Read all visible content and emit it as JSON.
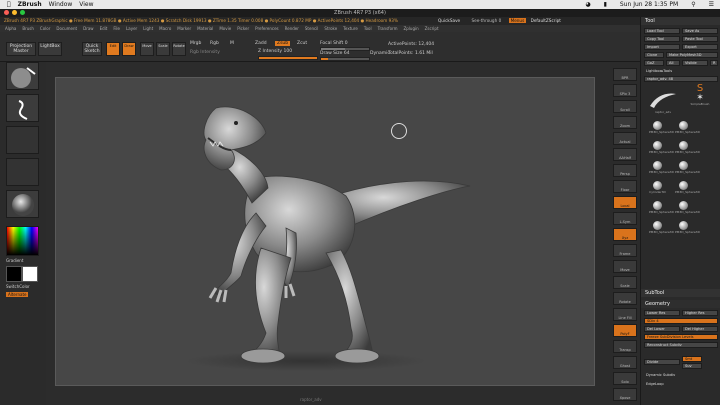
{
  "mac_menubar": {
    "app": "ZBrush",
    "menus": [
      "Window",
      "View"
    ],
    "clock": "Sun Jun 28  1:35 PM"
  },
  "window": {
    "title": "ZBrush 4R7 P3 (x64)"
  },
  "infobar": {
    "left": "ZBrush 4R7 P3 ZBrushGraphic  ● Free Mem 11.878GB ● Active Mem 1243 ● Scratch Disk 19913 ● ZTime 1.35 Timer 0.008 ● PolyCount 0.872 MP ● ActivePoints 12,404  ● Headroom 93%",
    "quicksave": "QuickSave",
    "seethrough": "See-through  0",
    "menus": "Menus",
    "script": "DefaultZScript"
  },
  "menubar": {
    "items": [
      "Alpha",
      "Brush",
      "Color",
      "Document",
      "Draw",
      "Edit",
      "File",
      "Layer",
      "Light",
      "Macro",
      "Marker",
      "Material",
      "Movie",
      "Picker",
      "Preferences",
      "Render",
      "Stencil",
      "Stroke",
      "Texture",
      "Tool",
      "Transform",
      "Zplugin",
      "Zscript"
    ]
  },
  "toolbar": {
    "projection_master": "Projection Master",
    "lightbox": "LightBox",
    "quick_sketch": "Quick Sketch",
    "edit": "Edit",
    "draw": "Draw",
    "move": "Move",
    "scale": "Scale",
    "rotate": "Rotate",
    "mrgb": "Mrgb",
    "rgb": "Rgb",
    "m": "M",
    "zadd": "Zadd",
    "zsub": "Zsub",
    "zcut": "Zcut",
    "rgb_intensity": "Rgb Intensity",
    "z_intensity": "Z Intensity 100",
    "focal_shift": "Focal Shift 0",
    "draw_size": "Draw Size 64",
    "dynamic": "Dynamic",
    "active_points": "ActivePoints: 12,404",
    "total_points": "TotalPoints: 1.61 Mil"
  },
  "left_shelf": {
    "gradient": "Gradient",
    "switch_color": "SwitchColor",
    "alternate": "Alternate"
  },
  "right_shelf": {
    "buttons": [
      "BPR",
      "SPix 3",
      "Scroll",
      "Zoom",
      "Actual",
      "AAHalf",
      "Persp",
      "Floor",
      "Local",
      "L.Sym",
      "Xyz",
      "Frame",
      "Move",
      "Scale",
      "Rotate",
      "Line Fill",
      "PolyF",
      "Transp",
      "Ghost",
      "Solo",
      "Xpose"
    ]
  },
  "canvas": {
    "bottom_label": "raptor_adv"
  },
  "tool_palette": {
    "title": "Tool",
    "buttons": [
      "Load Tool",
      "Save As",
      "Copy Tool",
      "Paste Tool",
      "Import",
      "Export",
      "Clone",
      "Make PolyMesh3D",
      "GoZ",
      "All",
      "Visible",
      "R"
    ],
    "lightbox_tools": "Lightbox▸Tools",
    "current_tool": "raptor_adv. 48",
    "tools": [
      "raptor_adv",
      "SimpleBrush",
      "PM3D_Sphere3D",
      "PM3D_Sphere3D",
      "PM3D_Sphere3D",
      "PM3D_Sphere3D",
      "PM3D_Sphere3D",
      "PM3D_Sphere3D",
      "Cylinder3D",
      "PM3D_Sphere3D",
      "PM3D_Sphere3D",
      "PM3D_Sphere3D",
      "PM3D_Sphere3D",
      "PM3D_Sphere3D"
    ],
    "subtool": "SubTool",
    "geometry": "Geometry",
    "lower_res": "Lower Res",
    "higher_res": "Higher Res",
    "sdiv": "SDiv 4",
    "del_lower": "Del Lower",
    "del_higher": "Del Higher",
    "freeze": "Freeze SubDivision Levels",
    "reconstruct": "Reconstruct Subdiv",
    "divide": "Divide",
    "smt": "Smt",
    "suv": "Suv",
    "dynamic_subdiv": "Dynamic Subdiv",
    "edge_loop": "EdgeLoop"
  },
  "colors": {
    "accent": "#e07a1f",
    "canvas_bg": "#474747",
    "panel_bg": "#2b2b2b"
  }
}
